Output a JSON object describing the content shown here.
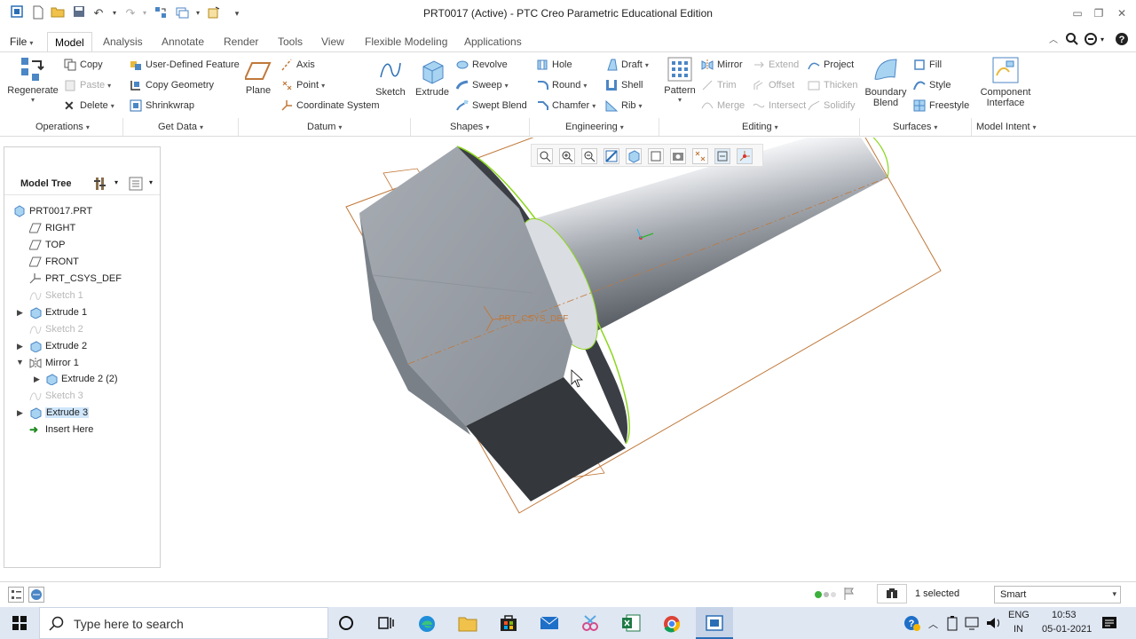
{
  "window": {
    "title": "PRT0017 (Active) - PTC Creo Parametric Educational Edition",
    "controls": [
      "minimize-icon",
      "restore-icon",
      "close-icon"
    ]
  },
  "tabs": [
    "File",
    "Model",
    "Analysis",
    "Annotate",
    "Render",
    "Tools",
    "View",
    "Flexible Modeling",
    "Applications"
  ],
  "ribbon": {
    "operations": {
      "regenerate": "Regenerate",
      "copy": "Copy",
      "paste": "Paste",
      "delete": "Delete"
    },
    "get_data": {
      "udf": "User-Defined Feature",
      "copy_geometry": "Copy Geometry",
      "shrinkwrap": "Shrinkwrap"
    },
    "datum": {
      "plane": "Plane",
      "axis": "Axis",
      "point": "Point",
      "csys": "Coordinate System"
    },
    "sketch": "Sketch",
    "shapes": {
      "extrude": "Extrude",
      "revolve": "Revolve",
      "sweep": "Sweep",
      "swept_blend": "Swept Blend"
    },
    "engineering": {
      "hole": "Hole",
      "round": "Round",
      "chamfer": "Chamfer",
      "draft": "Draft",
      "shell": "Shell",
      "rib": "Rib"
    },
    "editing": {
      "pattern": "Pattern",
      "mirror": "Mirror",
      "extend": "Extend",
      "trim": "Trim",
      "offset": "Offset",
      "merge": "Merge",
      "intersect": "Intersect",
      "project": "Project",
      "thicken": "Thicken",
      "solidify": "Solidify"
    },
    "surfaces": {
      "boundary_blend_1": "Boundary",
      "boundary_blend_2": "Blend",
      "fill": "Fill",
      "style": "Style",
      "freestyle": "Freestyle"
    },
    "model_intent": {
      "component_1": "Component",
      "component_2": "Interface"
    },
    "groups": [
      "Operations",
      "Get Data",
      "Datum",
      "Shapes",
      "Engineering",
      "Editing",
      "Surfaces",
      "Model Intent"
    ]
  },
  "model_tree": {
    "title": "Model Tree",
    "items": [
      {
        "label": "PRT0017.PRT",
        "dim": false
      },
      {
        "label": "RIGHT",
        "dim": false
      },
      {
        "label": "TOP",
        "dim": false
      },
      {
        "label": "FRONT",
        "dim": false
      },
      {
        "label": "PRT_CSYS_DEF",
        "dim": false
      },
      {
        "label": "Sketch 1",
        "dim": true
      },
      {
        "label": "Extrude 1",
        "dim": false
      },
      {
        "label": "Sketch 2",
        "dim": true
      },
      {
        "label": "Extrude 2",
        "dim": false
      },
      {
        "label": "Mirror 1",
        "dim": false
      },
      {
        "label": "Extrude 2 (2)",
        "dim": false
      },
      {
        "label": "Sketch 3",
        "dim": true
      },
      {
        "label": "Extrude 3",
        "dim": false
      },
      {
        "label": "Insert Here",
        "dim": false
      }
    ]
  },
  "viewport": {
    "csys_label": "PRT_CSYS_DEF"
  },
  "status": {
    "selected": "1 selected",
    "filter": "Smart"
  },
  "taskbar": {
    "search_placeholder": "Type here to search",
    "lang_1": "ENG",
    "lang_2": "IN",
    "time": "10:53",
    "date": "05-01-2021"
  },
  "colors": {
    "accent": "#3c8dd6",
    "highlight": "#cfe6fb",
    "edge_green": "#8bd61c",
    "datum_orange": "#c0783a"
  }
}
